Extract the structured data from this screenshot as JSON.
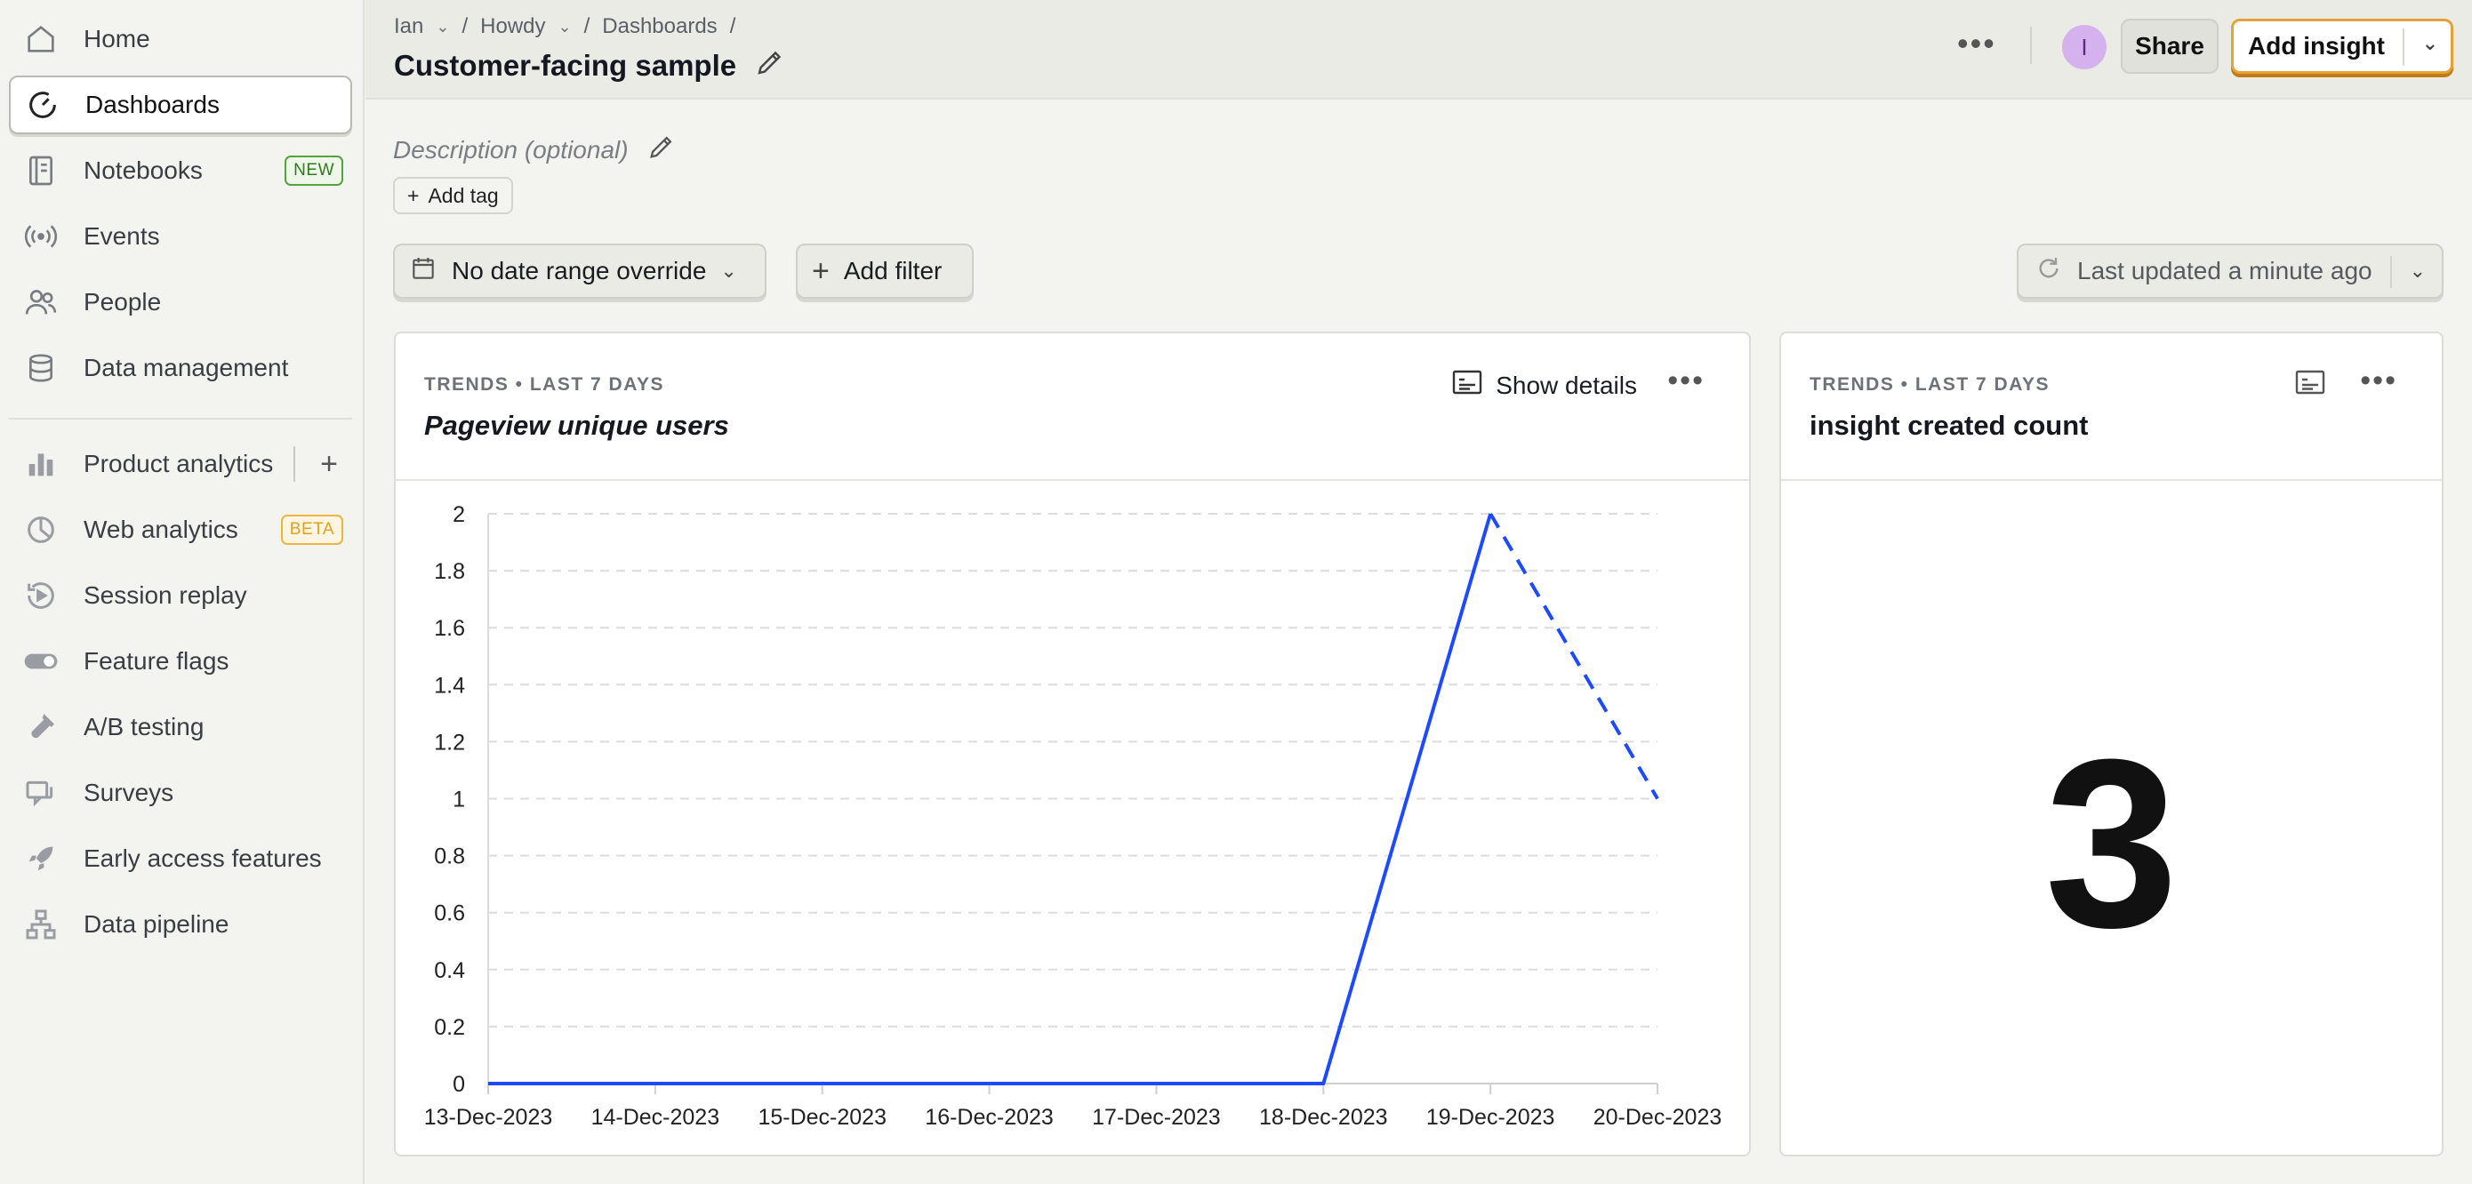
{
  "sidebar": {
    "items": [
      {
        "label": "Home",
        "icon": "home-icon"
      },
      {
        "label": "Dashboards",
        "icon": "dashboard-gauge-icon",
        "active": true
      },
      {
        "label": "Notebooks",
        "icon": "notebook-icon",
        "badge": "NEW"
      },
      {
        "label": "Events",
        "icon": "broadcast-icon"
      },
      {
        "label": "People",
        "icon": "people-icon"
      },
      {
        "label": "Data management",
        "icon": "database-icon"
      },
      {
        "label": "Product analytics",
        "icon": "bar-chart-icon",
        "plus": "+"
      },
      {
        "label": "Web analytics",
        "icon": "pie-chart-icon",
        "badge": "BETA"
      },
      {
        "label": "Session replay",
        "icon": "replay-icon"
      },
      {
        "label": "Feature flags",
        "icon": "toggle-icon"
      },
      {
        "label": "A/B testing",
        "icon": "flask-icon"
      },
      {
        "label": "Surveys",
        "icon": "survey-chat-icon"
      },
      {
        "label": "Early access features",
        "icon": "rocket-icon"
      },
      {
        "label": "Data pipeline",
        "icon": "pipeline-icon"
      }
    ]
  },
  "header": {
    "breadcrumbs": [
      "Ian",
      "Howdy",
      "Dashboards"
    ],
    "title": "Customer-facing sample",
    "avatar_initial": "I",
    "share_label": "Share",
    "add_insight_label": "Add insight"
  },
  "dashboard": {
    "description_placeholder": "Description (optional)",
    "add_tag_label": "Add tag",
    "date_range_label": "No date range override",
    "add_filter_label": "Add filter",
    "last_updated_label": "Last updated a minute ago"
  },
  "cards": [
    {
      "meta": "TRENDS • LAST 7 DAYS",
      "title": "Pageview unique users",
      "details_label": "Show details"
    },
    {
      "meta": "TRENDS • LAST 7 DAYS",
      "title": "insight created count",
      "value": "3"
    }
  ],
  "colors": {
    "accent": "#e5a23a",
    "series": "#1d4aff",
    "badge_new": "#2e7a1c",
    "badge_beta": "#e5a117"
  },
  "chart_data": {
    "type": "line",
    "x": [
      "13-Dec-2023",
      "14-Dec-2023",
      "15-Dec-2023",
      "16-Dec-2023",
      "17-Dec-2023",
      "18-Dec-2023",
      "19-Dec-2023",
      "20-Dec-2023"
    ],
    "series": [
      {
        "values": [
          0,
          0,
          0,
          0,
          0,
          0,
          2,
          1
        ],
        "dashed_from_index": 6
      }
    ],
    "y_ticks": [
      "0",
      "0.2",
      "0.4",
      "0.6",
      "0.8",
      "1",
      "1.2",
      "1.4",
      "1.6",
      "1.8",
      "2"
    ],
    "ylim": [
      0,
      2
    ],
    "grid": true,
    "legend": "none"
  }
}
